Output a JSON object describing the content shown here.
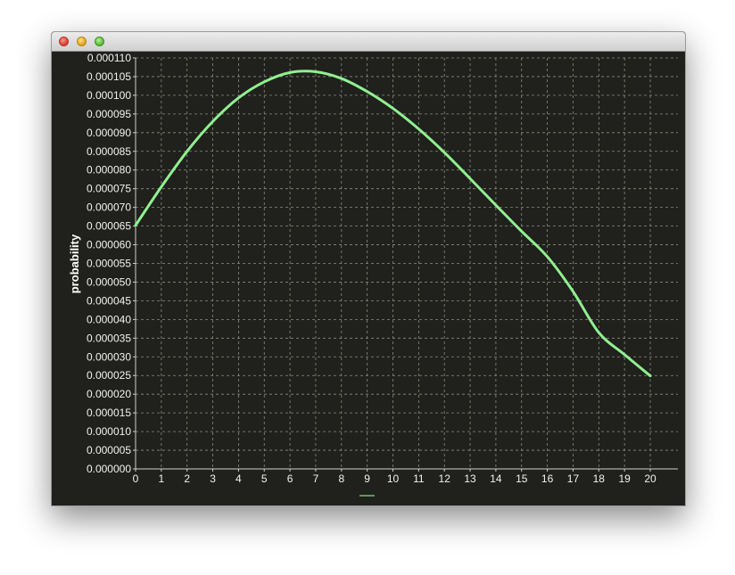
{
  "window": {
    "title": ""
  },
  "chart_data": {
    "type": "line",
    "title": "",
    "xlabel": "",
    "ylabel": "probability",
    "xlim": [
      0,
      20
    ],
    "ylim": [
      0,
      0.00011
    ],
    "grid": true,
    "x_ticks": [
      "0",
      "1",
      "2",
      "3",
      "4",
      "5",
      "6",
      "7",
      "8",
      "9",
      "10",
      "11",
      "12",
      "13",
      "14",
      "15",
      "16",
      "17",
      "18",
      "19",
      "20"
    ],
    "y_ticks": [
      "0.000000",
      "0.000005",
      "0.000010",
      "0.000015",
      "0.000020",
      "0.000025",
      "0.000030",
      "0.000035",
      "0.000040",
      "0.000045",
      "0.000050",
      "0.000055",
      "0.000060",
      "0.000065",
      "0.000070",
      "0.000075",
      "0.000080",
      "0.000085",
      "0.000090",
      "0.000095",
      "0.000100",
      "0.000105",
      "0.000110"
    ],
    "y_tick_values": [
      0,
      5e-06,
      1e-05,
      1.5e-05,
      2e-05,
      2.5e-05,
      3e-05,
      3.5e-05,
      4e-05,
      4.5e-05,
      5e-05,
      5.5e-05,
      6e-05,
      6.5e-05,
      7e-05,
      7.5e-05,
      8e-05,
      8.5e-05,
      9e-05,
      9.5e-05,
      0.0001,
      0.000105,
      0.00011
    ],
    "series": [
      {
        "color": "#90f090",
        "x": [
          0,
          1,
          2,
          3,
          4,
          5,
          6,
          7,
          8,
          9,
          10,
          11,
          12,
          13,
          14,
          15,
          16,
          17,
          18,
          19,
          20
        ],
        "y": [
          6.52e-05,
          7.55e-05,
          8.5e-05,
          9.3e-05,
          9.93e-05,
          0.0001036,
          0.0001061,
          0.0001063,
          0.0001045,
          0.000101,
          9.65e-05,
          9.1e-05,
          8.47e-05,
          7.77e-05,
          7.06e-05,
          6.36e-05,
          5.68e-05,
          4.75e-05,
          3.65e-05,
          3.06e-05,
          2.49e-05
        ]
      }
    ],
    "legend": {
      "position": "bottom",
      "entries": [
        {
          "color": "#5a9a5a"
        }
      ]
    }
  }
}
